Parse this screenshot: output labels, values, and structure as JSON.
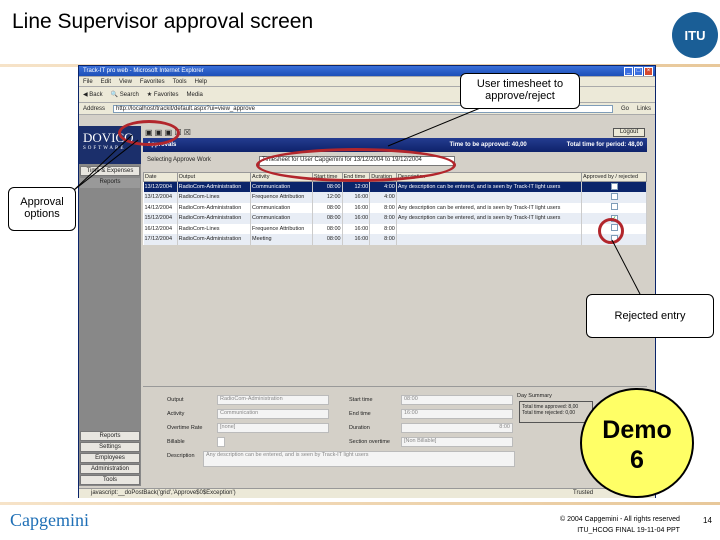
{
  "slide": {
    "title": "Line Supervisor approval screen",
    "logo": "ITU",
    "page": "14",
    "copyright": "© 2004 Capgemini - All rights reserved",
    "file": "ITU_HCOG FINAL 19-11-04 PPT",
    "company": "Capgemini",
    "demo_line1": "Demo",
    "demo_line2": "6"
  },
  "callouts": {
    "timesheet": "User timesheet to approve/reject",
    "approval": "Approval options",
    "rejected": "Rejected entry"
  },
  "browser": {
    "title": "Track-IT pro web - Microsoft Internet Explorer",
    "menu": [
      "File",
      "Edit",
      "View",
      "Favorites",
      "Tools",
      "Help"
    ],
    "toolbar": [
      "Back",
      "Search",
      "Favorites",
      "Media"
    ],
    "address_label": "Address",
    "address": "http://localhost/trackit/default.aspx?ui=view_approve",
    "go": "Go",
    "links": "Links",
    "status": "javascript:__doPostBack('grid','Approve$0$Exception')",
    "status_zone": "Trusted"
  },
  "app": {
    "brand": "DOVICO",
    "brand_sub": "SOFTWARE",
    "header": "Approvals",
    "to_approve": "Time to be approved: 40,00",
    "total": "Total time for period: 48,00",
    "logout": "Logout",
    "filter_label": "Selecting Approve Work",
    "filter_value": "Timesheet for User Capgemini for 13/12/2004 to 19/12/2004",
    "nav_top": [
      "Time & Expenses",
      "Reports"
    ],
    "nav_bottom": [
      "Reports",
      "Settings",
      "Employees",
      "Administration",
      "Tools"
    ],
    "columns": [
      "Date",
      "Output",
      "Activity",
      "Start time",
      "End time",
      "Duration",
      "Description",
      "Approved by / rejected"
    ],
    "rows": [
      {
        "date": "13/12/2004",
        "output": "RadioCom-Administration",
        "activity": "Communication",
        "start": "08:00",
        "end": "12:00",
        "duration": "4:00",
        "desc": "Any description can be entered, and is seen by Track-IT light users",
        "checked": false
      },
      {
        "date": "13/12/2004",
        "output": "RadioCom-Lines",
        "activity": "Frequence Attribution",
        "start": "12:00",
        "end": "16:00",
        "duration": "4:00",
        "desc": "",
        "checked": false
      },
      {
        "date": "14/12/2004",
        "output": "RadioCom-Administration",
        "activity": "Communication",
        "start": "08:00",
        "end": "16:00",
        "duration": "8:00",
        "desc": "Any description can be entered, and is seen by Track-IT light users",
        "checked": false
      },
      {
        "date": "15/12/2004",
        "output": "RadioCom-Administration",
        "activity": "Communication",
        "start": "08:00",
        "end": "16:00",
        "duration": "8:00",
        "desc": "Any description can be entered, and is seen by Track-IT light users",
        "checked": true
      },
      {
        "date": "16/12/2004",
        "output": "RadioCom-Lines",
        "activity": "Frequence Attribution",
        "start": "08:00",
        "end": "16:00",
        "duration": "8:00",
        "desc": "",
        "checked": false
      },
      {
        "date": "17/12/2004",
        "output": "RadioCom-Administration",
        "activity": "Meeting",
        "start": "08:00",
        "end": "16:00",
        "duration": "8:00",
        "desc": "",
        "checked": false
      }
    ],
    "form": {
      "output_label": "Output",
      "output": "RadioCom-Administration",
      "activity_label": "Activity",
      "activity": "Communication",
      "overtime_label": "Overtime Rate",
      "overtime": "[none]",
      "billable_label": "Billable",
      "desc_label": "Description",
      "desc": "Any description can be entered, and is seen by Track-IT light users",
      "start_label": "Start time",
      "start": "08:00",
      "end_label": "End time",
      "end": "16:00",
      "duration_label": "Duration",
      "duration": "8:00",
      "section_label": "Section overtime",
      "section": "[Non Billable]",
      "summary": "Day Summary",
      "sum1": "Total time approved: 8,00",
      "sum2": "Total time rejected: 0,00"
    }
  }
}
